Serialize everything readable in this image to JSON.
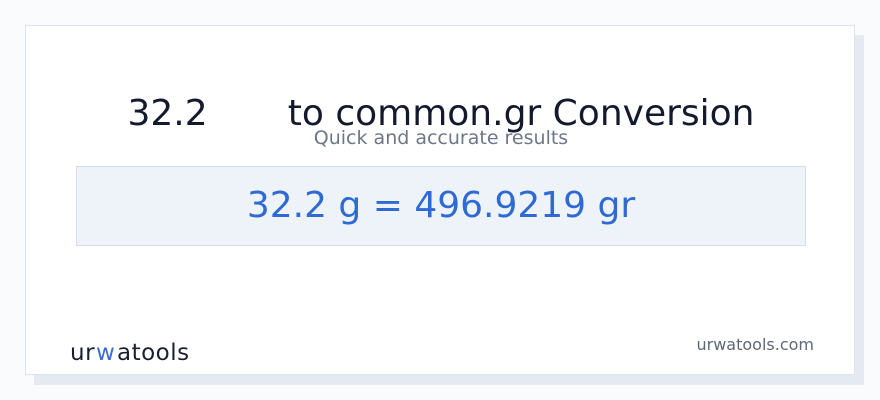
{
  "title": "32.2       to common.gr Conversion",
  "subtitle": "Quick and accurate results",
  "result": "32.2 g = 496.9219 gr",
  "logo_text": "urwatools",
  "site": "urwatools.com",
  "colors": {
    "accent": "#2f6ad2",
    "logo_accent": "#3b6fd4",
    "result_background": "#eef3f9"
  }
}
